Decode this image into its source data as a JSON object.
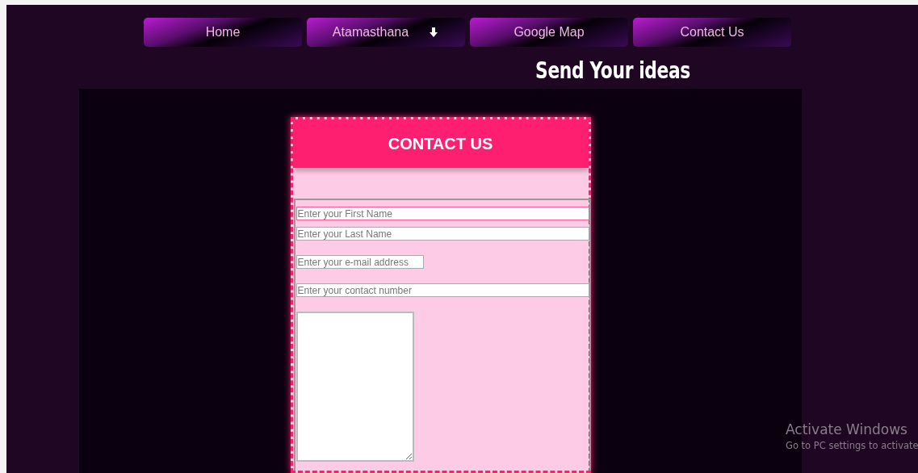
{
  "nav": [
    {
      "label": "Home",
      "has_dropdown": false
    },
    {
      "label": "Atamasthana",
      "has_dropdown": true
    },
    {
      "label": "Google Map",
      "has_dropdown": false
    },
    {
      "label": "Contact Us",
      "has_dropdown": false
    }
  ],
  "heading": "Send Your ideas",
  "contact_card": {
    "title": "CONTACT US",
    "fields": [
      {
        "kind": "input",
        "placeholder": "Enter your First Name",
        "focused": true
      },
      {
        "kind": "input",
        "placeholder": "Enter your Last Name",
        "focused": false
      },
      {
        "kind": "shortinput",
        "placeholder": "Enter your e-mail address",
        "focused": false
      },
      {
        "kind": "input",
        "placeholder": "Enter your contact number",
        "focused": false
      },
      {
        "kind": "textarea",
        "focused": false
      }
    ]
  },
  "os_notice": {
    "title": "Activate Windows",
    "subtitle": "Go to PC settings to activate"
  }
}
